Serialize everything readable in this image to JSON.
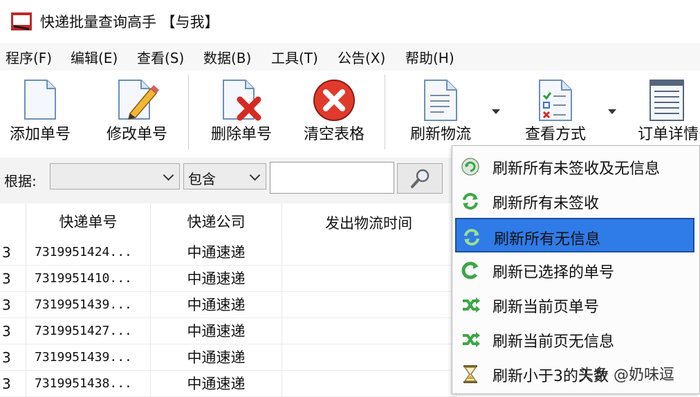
{
  "window": {
    "title": "快递批量查询高手 【与我】"
  },
  "menu": [
    "程序(F)",
    "编辑(E)",
    "查看(S)",
    "数据(B)",
    "工具(T)",
    "公告(X)",
    "帮助(H)"
  ],
  "toolbar": {
    "add": "添加单号",
    "edit": "修改单号",
    "delete": "删除单号",
    "clear": "清空表格",
    "refresh": "刷新物流",
    "view": "查看方式",
    "details": "订单详情"
  },
  "filter": {
    "label": "根据:",
    "field_value": "",
    "match_value": "包含",
    "search_value": ""
  },
  "table": {
    "headers": [
      "快递单号",
      "快递公司",
      "发出物流时间"
    ],
    "rows": [
      {
        "idx": "3",
        "num": "7319951424...",
        "company": "中通速递",
        "time": ""
      },
      {
        "idx": "3",
        "num": "7319951410...",
        "company": "中通速递",
        "time": ""
      },
      {
        "idx": "3",
        "num": "7319951439...",
        "company": "中通速递",
        "time": ""
      },
      {
        "idx": "3",
        "num": "7319951427...",
        "company": "中通速递",
        "time": ""
      },
      {
        "idx": "3",
        "num": "7319951439...",
        "company": "中通速递",
        "time": ""
      },
      {
        "idx": "3",
        "num": "7319951438...",
        "company": "中通速递",
        "time": ""
      }
    ]
  },
  "refresh_menu": {
    "items": [
      "刷新所有未签收及无信息",
      "刷新所有未签收",
      "刷新所有无信息",
      "刷新已选择的单号",
      "刷新当前页单号",
      "刷新当前页无信息",
      "刷新小于3的天数"
    ],
    "selected": 2
  },
  "watermark": "头条 @奶味逗",
  "colors": {
    "selection": "#2f7be8",
    "delete_red": "#e03a2c",
    "refresh_green": "#3aa845"
  }
}
